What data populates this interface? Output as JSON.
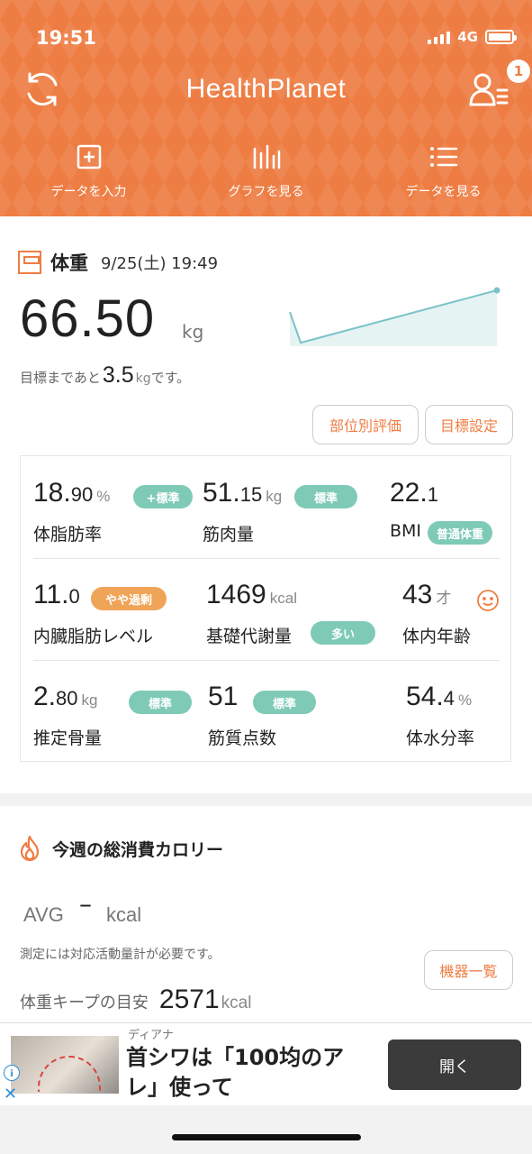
{
  "status": {
    "time": "19:51",
    "network": "4G"
  },
  "header": {
    "logo": "HealthPlanet",
    "notification_count": "1"
  },
  "nav": [
    {
      "label": "データを入力",
      "icon": "plus-square-icon"
    },
    {
      "label": "グラフを見る",
      "icon": "bar-graph-icon"
    },
    {
      "label": "データを見る",
      "icon": "list-icon"
    }
  ],
  "weight": {
    "title": "体重",
    "datetime": "9/25(土) 19:49",
    "value": "66.50",
    "unit": "kg",
    "goal_prefix": "目標まであと",
    "goal_value": "3.5",
    "goal_unit": "kg",
    "goal_suffix": "です。",
    "btn_parts": "部位別評価",
    "btn_goal": "目標設定",
    "trend": [
      66.2,
      66.5
    ]
  },
  "metrics": [
    {
      "int": "18.",
      "dec": "90",
      "unit": "%",
      "name": "体脂肪率",
      "badge": "+標準",
      "badge_color": "teal"
    },
    {
      "int": "51.",
      "dec": "15",
      "unit": "kg",
      "name": "筋肉量",
      "badge": "標準",
      "badge_color": "teal"
    },
    {
      "int": "22.",
      "dec": "1",
      "unit": "",
      "name": "BMI",
      "badge": "普通体重",
      "badge_color": "teal"
    },
    {
      "int": "11.",
      "dec": "0",
      "unit": "",
      "name": "内臓脂肪レベル",
      "badge": "やや過剰",
      "badge_color": "orange"
    },
    {
      "int": "1469",
      "dec": "",
      "unit": "kcal",
      "name": "基礎代謝量",
      "badge": "多い",
      "badge_color": "teal"
    },
    {
      "int": "43",
      "dec": "",
      "unit": "才",
      "name": "体内年齢",
      "badge": "",
      "badge_color": ""
    },
    {
      "int": "2.",
      "dec": "80",
      "unit": "kg",
      "name": "推定骨量",
      "badge": "標準",
      "badge_color": "teal"
    },
    {
      "int": "51",
      "dec": "",
      "unit": "",
      "name": "筋質点数",
      "badge": "標準",
      "badge_color": "teal"
    },
    {
      "int": "54.",
      "dec": "4",
      "unit": "%",
      "name": "体水分率",
      "badge": "",
      "badge_color": ""
    }
  ],
  "calories": {
    "title": "今週の総消費カロリー",
    "avg_label": "AVG",
    "avg_value": "–",
    "avg_unit": "kcal",
    "note": "測定には対応活動量計が必要です。",
    "btn_devices": "機器一覧",
    "keep_label": "体重キープの目安",
    "keep_value": "2571",
    "keep_unit": "kcal"
  },
  "ad": {
    "sponsor": "ディアナ",
    "text": "首シワは「100均のアレ」使って",
    "open_label": "開く"
  },
  "colors": {
    "accent": "#ee7d43",
    "teal": "#7ecab6",
    "orange_badge": "#f0a458"
  }
}
